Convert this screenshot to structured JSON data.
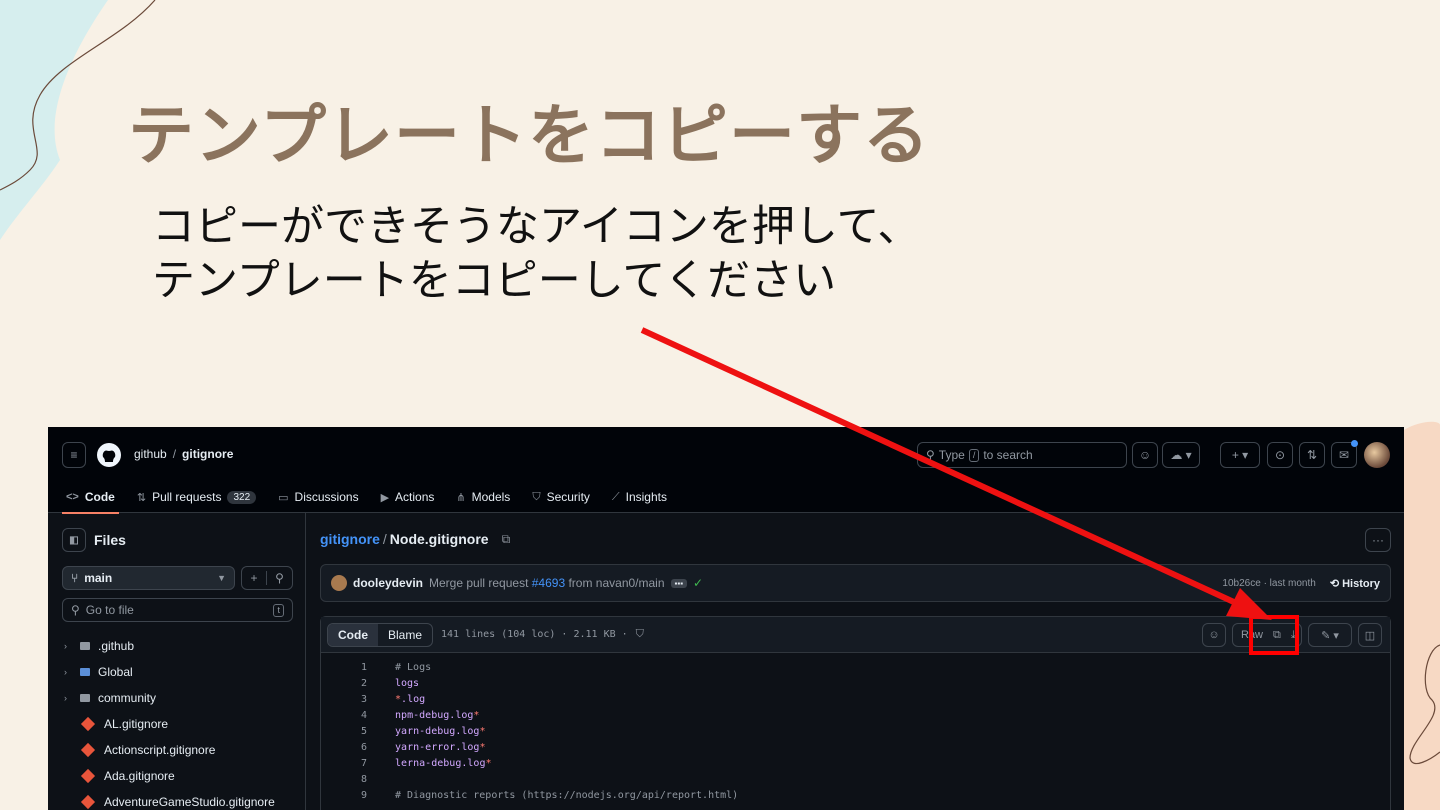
{
  "slide": {
    "title": "テンプレートをコピーする",
    "instruction_line1": "コピーができそうなアイコンを押して、",
    "instruction_line2": "テンプレートをコピーしてください",
    "accent_color": "#8b735d",
    "highlight_color": "#ff0000"
  },
  "github": {
    "owner": "github",
    "repo": "gitignore",
    "search_placeholder_prefix": "Type",
    "search_key": "/",
    "search_placeholder_suffix": "to search",
    "tabs": [
      {
        "label": "Code",
        "icon": "code-icon"
      },
      {
        "label": "Pull requests",
        "icon": "pull-request-icon",
        "count": "322"
      },
      {
        "label": "Discussions",
        "icon": "discussions-icon"
      },
      {
        "label": "Actions",
        "icon": "play-icon"
      },
      {
        "label": "Models",
        "icon": "models-icon"
      },
      {
        "label": "Security",
        "icon": "shield-icon"
      },
      {
        "label": "Insights",
        "icon": "graph-icon"
      }
    ],
    "sidebar": {
      "title": "Files",
      "branch": "main",
      "goto_placeholder": "Go to file",
      "goto_key": "t",
      "tree": [
        {
          "name": ".github",
          "kind": "folder"
        },
        {
          "name": "Global",
          "kind": "folder-blue"
        },
        {
          "name": "community",
          "kind": "folder"
        },
        {
          "name": "AL.gitignore",
          "kind": "file"
        },
        {
          "name": "Actionscript.gitignore",
          "kind": "file"
        },
        {
          "name": "Ada.gitignore",
          "kind": "file"
        },
        {
          "name": "AdventureGameStudio.gitignore",
          "kind": "file"
        }
      ]
    },
    "breadcrumb": {
      "repo": "gitignore",
      "file": "Node.gitignore"
    },
    "commit": {
      "author": "dooleydevin",
      "message_prefix": "Merge pull request",
      "pr": "#4693",
      "message_suffix": "from navan0/main",
      "sha_time": "10b26ce · last month",
      "history_label": "History"
    },
    "file": {
      "tab_code": "Code",
      "tab_blame": "Blame",
      "meta": "141 lines (104 loc) · 2.11 KB ·",
      "raw_label": "Raw",
      "lines": [
        {
          "n": "1",
          "text": "# Logs",
          "style": "cm"
        },
        {
          "n": "2",
          "text": "logs",
          "style": "pu"
        },
        {
          "n": "3",
          "text": "*.log",
          "style": "pu"
        },
        {
          "n": "4",
          "text": "npm-debug.log*",
          "style": "pu"
        },
        {
          "n": "5",
          "text": "yarn-debug.log*",
          "style": "pu"
        },
        {
          "n": "6",
          "text": "yarn-error.log*",
          "style": "pu"
        },
        {
          "n": "7",
          "text": "lerna-debug.log*",
          "style": "pu"
        },
        {
          "n": "8",
          "text": "",
          "style": "pu"
        },
        {
          "n": "9",
          "text": "# Diagnostic reports (https://nodejs.org/api/report.html)",
          "style": "cm"
        }
      ]
    }
  }
}
